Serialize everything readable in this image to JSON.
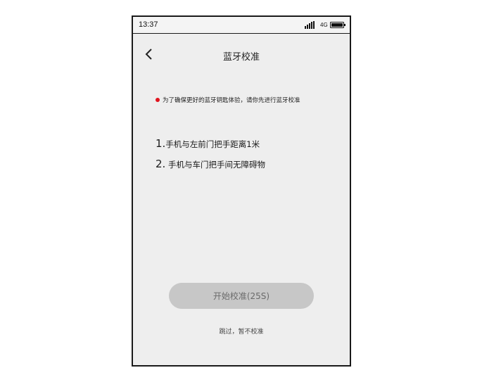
{
  "status_bar": {
    "time": "13:37",
    "network": "4G",
    "signal_icon": "signal-bars-icon",
    "battery_icon": "battery-icon"
  },
  "nav": {
    "title": "蓝牙校准",
    "back_icon": "chevron-left-icon"
  },
  "notice": {
    "text": "为了确保更好的蓝牙钥匙体验，请你先进行蓝牙校准",
    "dot_color": "#e0141e"
  },
  "steps": [
    {
      "number": "1.",
      "text": "手机与左前门把手距离1米"
    },
    {
      "number": "2.",
      "text": " 手机与车门把手间无障碍物"
    }
  ],
  "actions": {
    "start_label": "开始校准(25S)",
    "skip_label": "跳过，暂不校准"
  }
}
